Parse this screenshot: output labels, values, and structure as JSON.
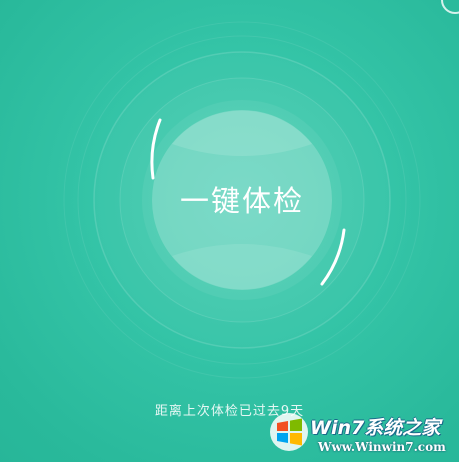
{
  "check": {
    "label": "一键体检"
  },
  "status": {
    "text": "距离上次体检已过去9天"
  },
  "watermark": {
    "title": "Win7系统之家",
    "url": "Www.Winwin7.com"
  },
  "colors": {
    "background": "#2bbc9e",
    "accent": "#ffffff"
  },
  "icons": {
    "corner": "ring-icon",
    "logo": "windows-logo-icon"
  }
}
